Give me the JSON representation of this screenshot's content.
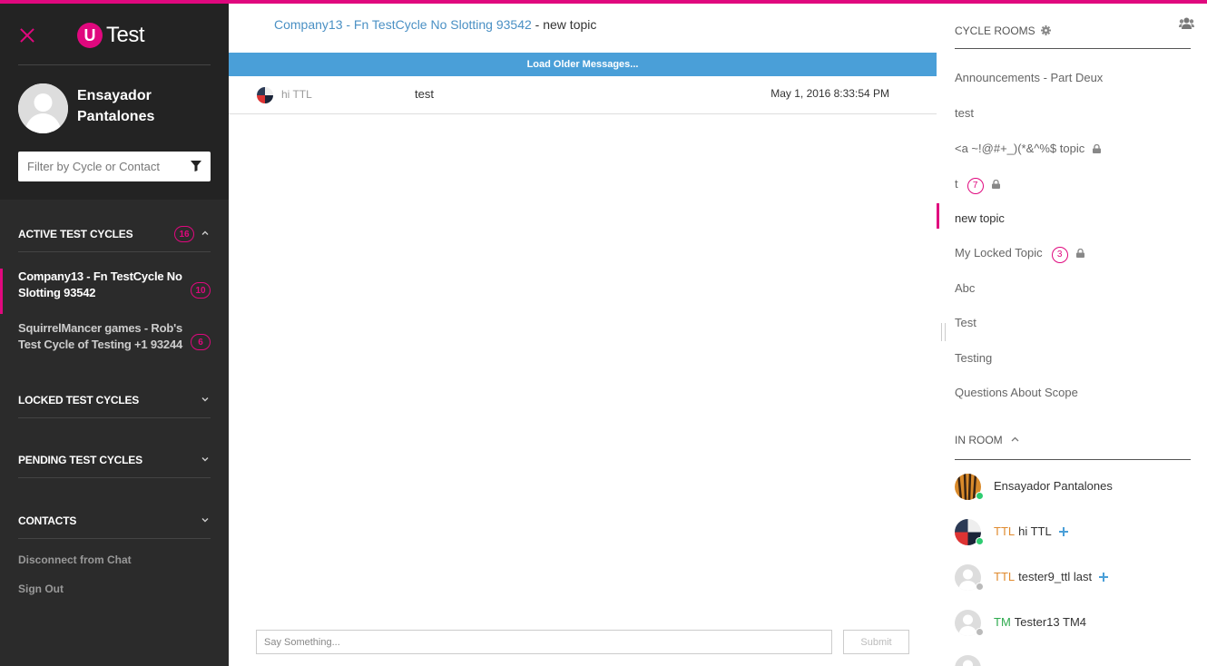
{
  "app": {
    "logo_letter": "U",
    "logo_text": "Test",
    "accent_color": "#e0087e"
  },
  "sidebar": {
    "user_name": "Ensayador Pantalones",
    "filter_placeholder": "Filter by Cycle or Contact",
    "sections": {
      "active": {
        "title": "ACTIVE TEST CYCLES",
        "count": "16"
      },
      "locked": {
        "title": "LOCKED TEST CYCLES"
      },
      "pending": {
        "title": "PENDING TEST CYCLES"
      },
      "contacts": {
        "title": "CONTACTS"
      }
    },
    "cycles": [
      {
        "label": "Company13 - Fn TestCycle No Slotting 93542",
        "count": "10"
      },
      {
        "label": "SquirrelMancer games - Rob's Test Cycle of Testing +1 93244",
        "count": "6"
      }
    ],
    "links": {
      "disconnect": "Disconnect from Chat",
      "sign_out": "Sign Out"
    }
  },
  "main": {
    "breadcrumb": {
      "cycle": "Company13 - Fn TestCycle No Slotting 93542",
      "separator": " - ",
      "topic": "new topic"
    },
    "load_older": "Load Older Messages...",
    "messages": [
      {
        "author": "hi TTL",
        "text": "test",
        "time": "May 1, 2016 8:33:54 PM"
      }
    ],
    "composer": {
      "placeholder": "Say Something...",
      "submit": "Submit"
    }
  },
  "rooms": {
    "header": "CYCLE ROOMS",
    "items": [
      {
        "label": "Announcements - Part Deux"
      },
      {
        "label": "test"
      },
      {
        "label": "<a ~!@#+_)(*&^%$ topic"
      },
      {
        "label": "t",
        "count": "7"
      },
      {
        "label": "new topic"
      },
      {
        "label": "My Locked Topic",
        "count": "3"
      },
      {
        "label": "Abc"
      },
      {
        "label": "Test"
      },
      {
        "label": "Testing"
      },
      {
        "label": "Questions About Scope"
      }
    ]
  },
  "in_room": {
    "header": "IN ROOM",
    "members": [
      {
        "role": "",
        "name": "Ensayador Pantalones",
        "role_color": "#e08a2e",
        "status_color": "#2ecc71"
      },
      {
        "role": "TTL",
        "name": "hi TTL",
        "role_color": "#e08a2e",
        "status_color": "#2ecc71"
      },
      {
        "role": "TTL",
        "name": "tester9_ttl last",
        "role_color": "#e08a2e",
        "status_color": "#bbbbbb"
      },
      {
        "role": "TM",
        "name": "Tester13 TM4",
        "role_color": "#2eaa4e",
        "status_color": "#bbbbbb"
      }
    ]
  }
}
